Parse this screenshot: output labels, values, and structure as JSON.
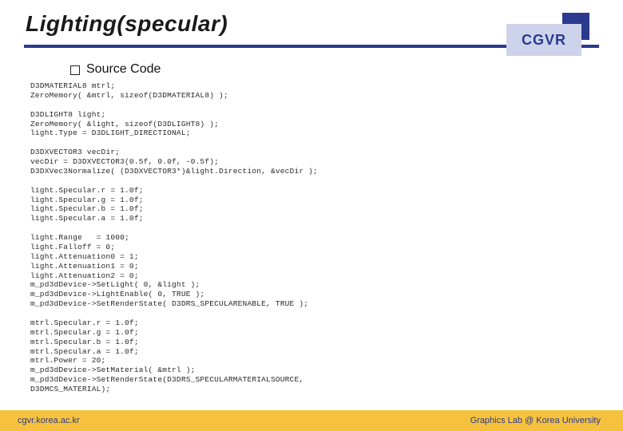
{
  "title": "Lighting(specular)",
  "badge": "CGVR",
  "section_heading": "Source Code",
  "code": "D3DMATERIAL8 mtrl;\nZeroMemory( &mtrl, sizeof(D3DMATERIAL8) );\n\nD3DLIGHT8 light;\nZeroMemory( &light, sizeof(D3DLIGHT8) );\nlight.Type = D3DLIGHT_DIRECTIONAL;\n\nD3DXVECTOR3 vecDir;\nvecDir = D3DXVECTOR3(0.5f, 0.0f, -0.5f);\nD3DXVec3Normalize( (D3DXVECTOR3*)&light.Direction, &vecDir );\n\nlight.Specular.r = 1.0f;\nlight.Specular.g = 1.0f;\nlight.Specular.b = 1.0f;\nlight.Specular.a = 1.0f;\n\nlight.Range   = 1000;\nlight.Falloff = 0;\nlight.Attenuation0 = 1;\nlight.Attenuation1 = 0;\nlight.Attenuation2 = 0;\nm_pd3dDevice->SetLight( 0, &light );\nm_pd3dDevice->LightEnable( 0, TRUE );\nm_pd3dDevice->SetRenderState( D3DRS_SPECULARENABLE, TRUE );\n\nmtrl.Specular.r = 1.0f;\nmtrl.Specular.g = 1.0f;\nmtrl.Specular.b = 1.0f;\nmtrl.Specular.a = 1.0f;\nmtrl.Power = 20;\nm_pd3dDevice->SetMaterial( &mtrl );\nm_pd3dDevice->SetRenderState(D3DRS_SPECULARMATERIALSOURCE,\nD3DMCS_MATERIAL);",
  "footer": {
    "left": "cgvr.korea.ac.kr",
    "right": "Graphics Lab @ Korea University"
  }
}
